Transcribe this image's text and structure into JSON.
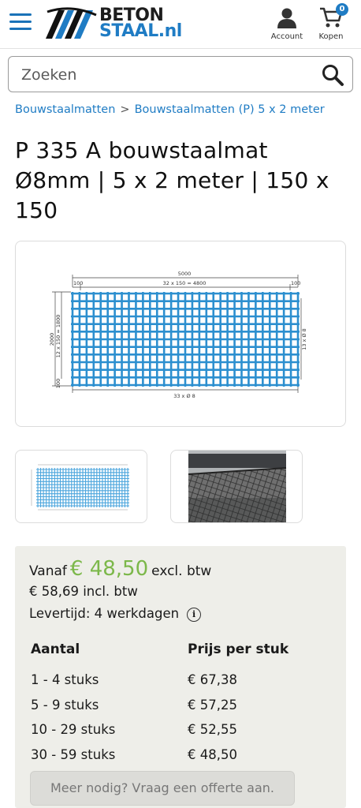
{
  "header": {
    "logo_line1": "BETON",
    "logo_line2": "STAAL.nl",
    "account_label": "Account",
    "cart_label": "Kopen",
    "cart_count": "0",
    "accent_color": "#1f7cc4"
  },
  "search": {
    "placeholder": "Zoeken",
    "value": ""
  },
  "breadcrumb": {
    "items": [
      "Bouwstaalmatten",
      "Bouwstaalmatten (P) 5 x 2 meter"
    ],
    "separator": ">"
  },
  "product": {
    "title": "P 335 A bouwstaalmat Ø8mm | 5 x 2 meter | 150 x 150"
  },
  "drawing": {
    "total_width": "5000",
    "edge_left": "100",
    "edge_right": "100",
    "inner_width": "32 x 150 = 4800",
    "total_height": "2000",
    "inner_height": "12 x 150 = 1800",
    "edge_bottom": "100",
    "bottom_bars": "33 x Ø 8",
    "side_bars": "13 x Ø 8"
  },
  "pricing": {
    "vanaf_label": "Vanaf",
    "price_excl": "€ 48,50",
    "excl_label": "excl. btw",
    "price_incl_line": "€ 58,69 incl. btw",
    "levertijd": "Levertijd: 4 werkdagen",
    "info_icon": "i",
    "col_qty": "Aantal",
    "col_price": "Prijs per stuk",
    "tiers": [
      {
        "qty": "1 - 4 stuks",
        "price": "€ 67,38"
      },
      {
        "qty": "5 - 9 stuks",
        "price": "€ 57,25"
      },
      {
        "qty": "10 - 29 stuks",
        "price": "€ 52,55"
      },
      {
        "qty": "30 - 59 stuks",
        "price": "€ 48,50"
      }
    ],
    "quote_button": "Meer nodig? Vraag een offerte aan.",
    "price_color": "#7cb84a"
  }
}
